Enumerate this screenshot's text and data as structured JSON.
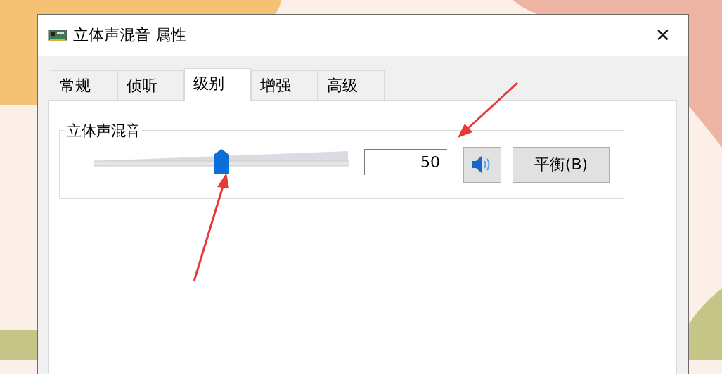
{
  "window": {
    "title": "立体声混音 属性",
    "close": "✕"
  },
  "tabs": [
    {
      "label": "常规",
      "selected": false
    },
    {
      "label": "侦听",
      "selected": false
    },
    {
      "label": "级别",
      "selected": true
    },
    {
      "label": "增强",
      "selected": false
    },
    {
      "label": "高级",
      "selected": false
    }
  ],
  "group": {
    "title": "立体声混音",
    "slider": {
      "level": 0.5
    },
    "value": "50",
    "muted": false,
    "balance_button": "平衡(B)"
  }
}
